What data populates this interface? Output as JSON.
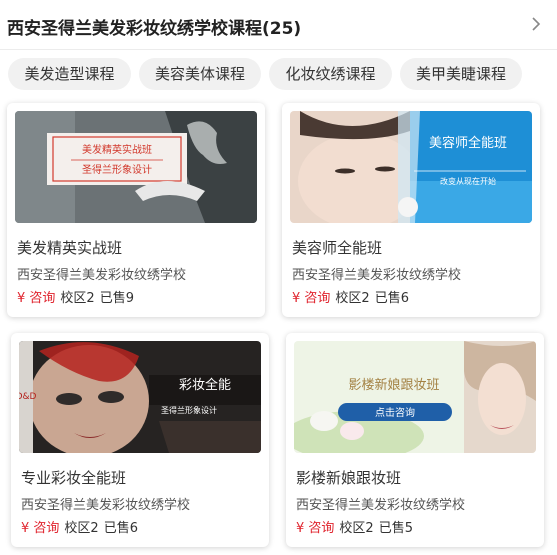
{
  "header": {
    "title": "西安圣得兰美发彩妆纹绣学校课程(25)",
    "chevron_icon": "chevron-right-icon"
  },
  "tabs": [
    {
      "label": "美发造型课程"
    },
    {
      "label": "美容美体课程"
    },
    {
      "label": "化妆纹绣课程"
    },
    {
      "label": "美甲美睫课程"
    }
  ],
  "courses": [
    {
      "name": "美发精英实战班",
      "school": "西安圣得兰美发彩妆纹绣学校",
      "price": "¥ 咨询",
      "campus": "校区2",
      "sold": "已售9",
      "banner_line1": "美发精英实战班",
      "banner_line2": "圣得兰形象设计"
    },
    {
      "name": "美容师全能班",
      "school": "西安圣得兰美发彩妆纹绣学校",
      "price": "¥ 咨询",
      "campus": "校区2",
      "sold": "已售6",
      "banner_line1": "美容师全能班",
      "banner_line2": "改变从现在开始"
    },
    {
      "name": "专业彩妆全能班",
      "school": "西安圣得兰美发彩妆纹绣学校",
      "price": "¥ 咨询",
      "campus": "校区2",
      "sold": "已售6",
      "banner_line1": "彩妆全能",
      "banner_line2": "圣得兰形象设计"
    },
    {
      "name": "影楼新娘跟妆班",
      "school": "西安圣得兰美发彩妆纹绣学校",
      "price": "¥ 咨询",
      "campus": "校区2",
      "sold": "已售5",
      "banner_line1": "影楼新娘跟妆班",
      "banner_line2": "点击咨询"
    }
  ],
  "colors": {
    "price": "#e0242e",
    "tab_bg": "#f1f1f1",
    "banner_blue": "#1e8fd6"
  }
}
